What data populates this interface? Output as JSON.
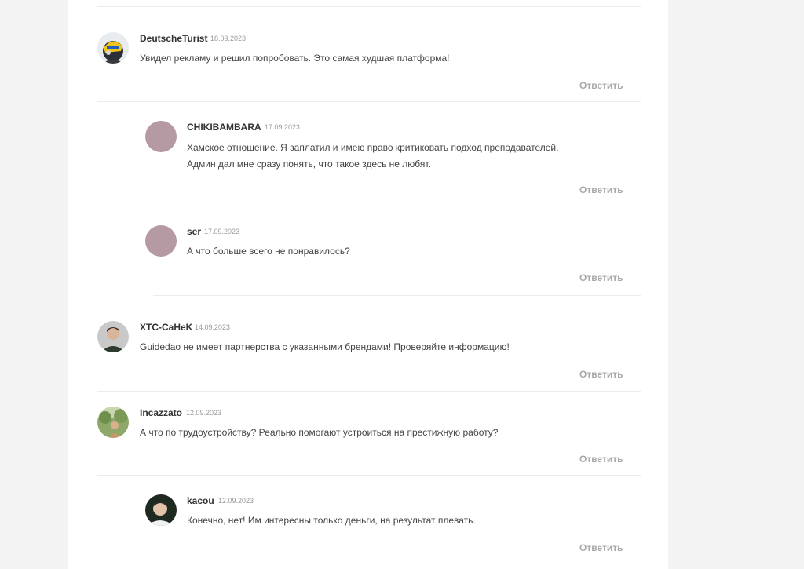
{
  "comments": [
    {
      "author": "DeutscheTurist",
      "date": "18.09.2023",
      "lines": [
        "Увидел рекламу и решил попробовать. Это самая худшая платформа!"
      ],
      "reply_label": "Ответить",
      "avatar": "helmet-photo-avatar"
    },
    {
      "author": "CHIKIBAMBARA",
      "date": "17.09.2023",
      "lines": [
        "Хамское отношение. Я заплатил и имею право критиковать подход преподавателей.",
        "Админ дал мне сразу понять, что такое здесь не любят."
      ],
      "reply_label": "Ответить",
      "avatar": "default-avatar"
    },
    {
      "author": "ser",
      "date": "17.09.2023",
      "lines": [
        "А что больше всего не понравилось?"
      ],
      "reply_label": "Ответить",
      "avatar": "default-avatar"
    },
    {
      "author": "XTC-CaHeK",
      "date": "14.09.2023",
      "lines": [
        "Guidedao не имеет партнерства с указанными брендами! Проверяйте информацию!"
      ],
      "reply_label": "Ответить",
      "avatar": "man-photo-avatar"
    },
    {
      "author": "Incazzato",
      "date": "12.09.2023",
      "lines": [
        "А что по трудоустройству? Реально помогают устроиться на престижную работу?"
      ],
      "reply_label": "Ответить",
      "avatar": "outdoor-photo-avatar"
    },
    {
      "author": "kacou",
      "date": "12.09.2023",
      "lines": [
        "Конечно, нет! Им интересны только деньги, на результат плевать."
      ],
      "reply_label": "Ответить",
      "avatar": "man-photo-avatar"
    }
  ],
  "colors": {
    "page_bg": "#f3f3f3",
    "panel_bg": "#ffffff",
    "default_avatar": "#b59aa3",
    "reply_text": "#a9a9a9",
    "divider": "#ececec"
  }
}
